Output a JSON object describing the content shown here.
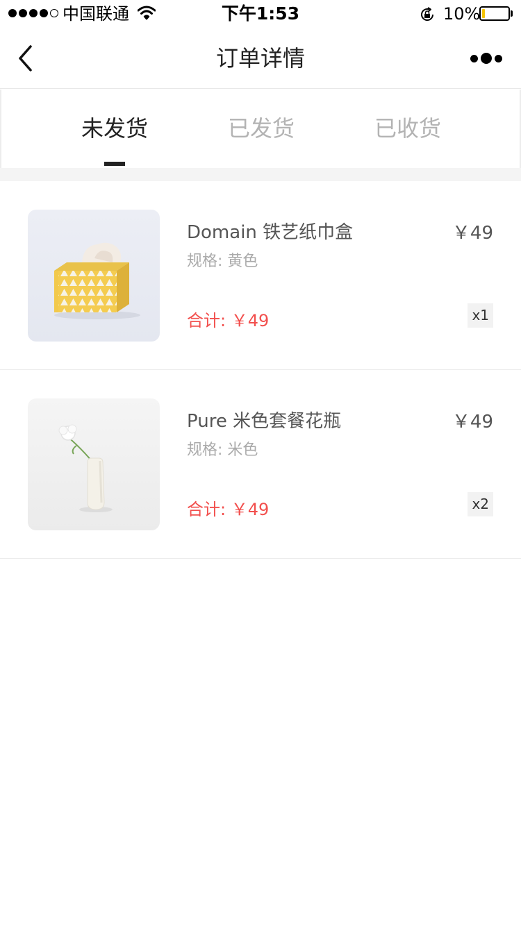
{
  "status_bar": {
    "carrier": "中国联通",
    "time": "下午1:53",
    "battery_percent": "10%",
    "battery_level": 0.1,
    "battery_color": "#f5c400"
  },
  "nav": {
    "title": "订单详情",
    "back_icon": "chevron-left-icon",
    "more_icon": "more-dots-icon"
  },
  "tabs": [
    {
      "label": "未发货",
      "active": true
    },
    {
      "label": "已发货",
      "active": false
    },
    {
      "label": "已收货",
      "active": false
    }
  ],
  "orders": [
    {
      "name": "Domain 铁艺纸巾盒",
      "spec_label": "规格:",
      "spec_value": "黄色",
      "total_label": "合计:",
      "total_value": "￥49",
      "price": "￥49",
      "quantity": "x1",
      "image": "yellow-tissue-box-image"
    },
    {
      "name": "Pure 米色套餐花瓶",
      "spec_label": "规格:",
      "spec_value": "米色",
      "total_label": "合计:",
      "total_value": "￥49",
      "price": "￥49",
      "quantity": "x2",
      "image": "white-vase-flower-image"
    }
  ],
  "colors": {
    "accent_red": "#f2504e",
    "text_dark": "#222222",
    "text_inactive": "#b3b3b3"
  }
}
